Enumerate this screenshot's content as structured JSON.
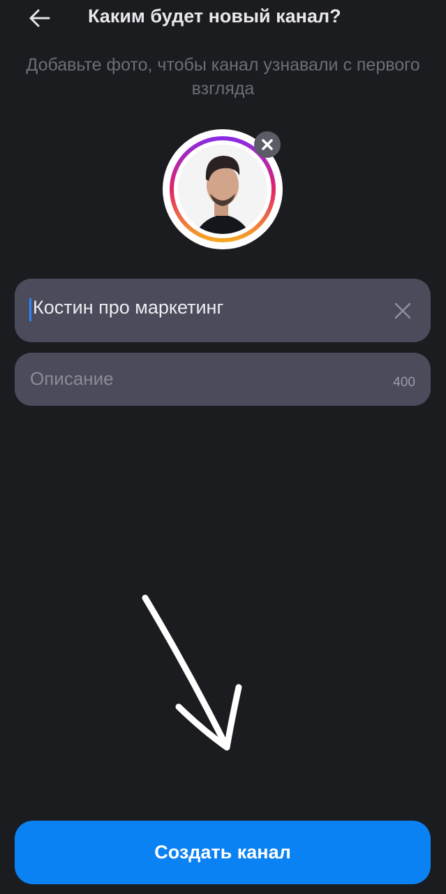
{
  "header": {
    "back_icon": "arrow-left-icon",
    "title": "Каким будет новый канал?"
  },
  "subtitle": "Добавьте фото, чтобы канал узнавали с первого взгляда",
  "avatar": {
    "remove_icon": "close-icon",
    "ring_colors": [
      "#8a2be2",
      "#e0246a",
      "#f5a623"
    ]
  },
  "name_field": {
    "value": "Костин про маркетинг",
    "clear_icon": "close-icon"
  },
  "description_field": {
    "placeholder": "Описание",
    "counter": "400"
  },
  "annotation": {
    "icon": "hand-drawn-arrow-icon",
    "color": "#ffffff"
  },
  "create_button": {
    "label": "Создать канал",
    "color": "#0b82f4"
  }
}
